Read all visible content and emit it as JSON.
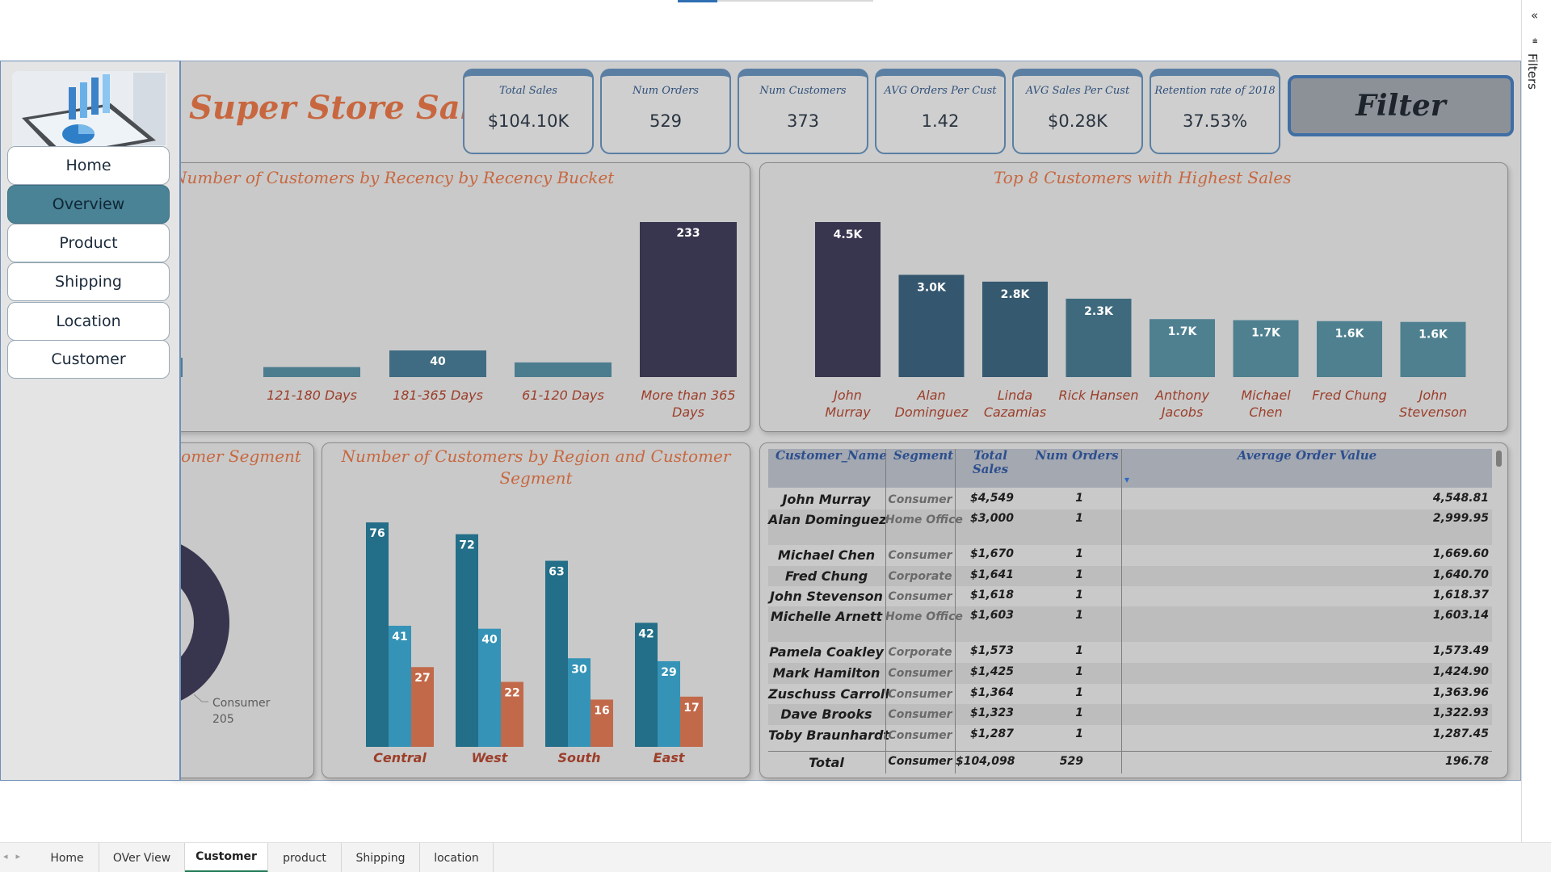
{
  "report_title": "Super Store Sales",
  "filter_button": "Filter",
  "filters_pane": {
    "label": "Filters",
    "collapse_glyph": "«",
    "funnel_glyph": "⩧"
  },
  "nav": [
    {
      "label": "Home",
      "active": false
    },
    {
      "label": "Overview",
      "active": true
    },
    {
      "label": "Product",
      "active": false
    },
    {
      "label": "Shipping",
      "active": false
    },
    {
      "label": "Location",
      "active": false
    },
    {
      "label": "Customer",
      "active": false
    }
  ],
  "kpis": [
    {
      "label": "Total Sales",
      "value": "$104.10K"
    },
    {
      "label": "Num Orders",
      "value": "529"
    },
    {
      "label": "Num Customers",
      "value": "373"
    },
    {
      "label": "AVG Orders Per Cust",
      "value": "1.42"
    },
    {
      "label": "AVG Sales Per Cust",
      "value": "$0.28K"
    },
    {
      "label": "Retention rate of 2018",
      "value": "37.53%"
    }
  ],
  "panels": {
    "recency": {
      "title": "Number of Customers by Recency by Recency Bucket"
    },
    "top_customers": {
      "title": "Top 8 Customers with Highest Sales"
    },
    "segment": {
      "title": "Number of Customers by Customer Segment"
    },
    "region": {
      "title_line1": "Number of Customers by Region and Customer",
      "title_line2": "Segment"
    }
  },
  "chart_data": [
    {
      "id": "recency",
      "type": "bar",
      "title": "Number of Customers by Recency by Recency Bucket",
      "categories": [
        "",
        "121-180 Days",
        "181-365 Days",
        "61-120 Days",
        "More than 365 Days"
      ],
      "values": [
        29,
        15,
        40,
        22,
        233
      ],
      "data_labels": [
        "",
        "",
        "40",
        "",
        "233"
      ],
      "colors": [
        "#4b7d8f",
        "#4b7d8f",
        "#3f6c82",
        "#4b7d8f",
        "#38354e"
      ]
    },
    {
      "id": "top_customers",
      "type": "bar",
      "title": "Top 8 Customers with Highest Sales",
      "categories": [
        "John Murray",
        "Alan Dominguez",
        "Linda Cazamias",
        "Rick Hansen",
        "Anthony Jacobs",
        "Michael Chen",
        "Fred Chung",
        "John Stevenson"
      ],
      "values": [
        4549,
        3000,
        2800,
        2300,
        1700,
        1670,
        1641,
        1618
      ],
      "data_labels": [
        "4.5K",
        "3.0K",
        "2.8K",
        "2.3K",
        "1.7K",
        "1.7K",
        "1.6K",
        "1.6K"
      ],
      "colors": [
        "#38354e",
        "#34566f",
        "#35596f",
        "#3f6a7e",
        "#4e8090",
        "#4e8090",
        "#4e8090",
        "#4e8090"
      ]
    },
    {
      "id": "segment",
      "type": "pie",
      "title": "Number of Customers by Customer Segment",
      "slices": [
        {
          "label": "Consumer",
          "value": 205,
          "color": "#38354e"
        }
      ],
      "visible_label": {
        "name": "Consumer",
        "value": "205"
      }
    },
    {
      "id": "region",
      "type": "bar",
      "title": "Number of Customers by Region and Customer Segment",
      "categories": [
        "Central",
        "West",
        "South",
        "East"
      ],
      "series": [
        {
          "values": [
            76,
            72,
            63,
            42
          ],
          "color": "#236e88"
        },
        {
          "values": [
            41,
            40,
            30,
            29
          ],
          "color": "#3493b6"
        },
        {
          "values": [
            27,
            22,
            16,
            17
          ],
          "color": "#c2694a"
        }
      ]
    }
  ],
  "table": {
    "headers": {
      "name": "Customer_Name",
      "segment": "Segment",
      "sales_1": "Total",
      "sales_2": "Sales",
      "orders": "Num Orders",
      "aov": "Average Order Value"
    },
    "sort_glyph": "▾",
    "rows": [
      {
        "name": "John Murray",
        "segment": "Consumer",
        "sales": "$4,549",
        "orders": "1",
        "aov": "4,548.81"
      },
      {
        "name": "Alan Dominguez",
        "segment": "Home Office",
        "sales": "$3,000",
        "orders": "1",
        "aov": "2,999.95"
      },
      {
        "name": "Michael Chen",
        "segment": "Consumer",
        "sales": "$1,670",
        "orders": "1",
        "aov": "1,669.60"
      },
      {
        "name": "Fred Chung",
        "segment": "Corporate",
        "sales": "$1,641",
        "orders": "1",
        "aov": "1,640.70"
      },
      {
        "name": "John Stevenson",
        "segment": "Consumer",
        "sales": "$1,618",
        "orders": "1",
        "aov": "1,618.37"
      },
      {
        "name": "Michelle Arnett",
        "segment": "Home Office",
        "sales": "$1,603",
        "orders": "1",
        "aov": "1,603.14"
      },
      {
        "name": "Pamela Coakley",
        "segment": "Corporate",
        "sales": "$1,573",
        "orders": "1",
        "aov": "1,573.49"
      },
      {
        "name": "Mark Hamilton",
        "segment": "Consumer",
        "sales": "$1,425",
        "orders": "1",
        "aov": "1,424.90"
      },
      {
        "name": "Zuschuss Carroll",
        "segment": "Consumer",
        "sales": "$1,364",
        "orders": "1",
        "aov": "1,363.96"
      },
      {
        "name": "Dave Brooks",
        "segment": "Consumer",
        "sales": "$1,323",
        "orders": "1",
        "aov": "1,322.93"
      },
      {
        "name": "Toby Braunhardt",
        "segment": "Consumer",
        "sales": "$1,287",
        "orders": "1",
        "aov": "1,287.45"
      }
    ],
    "total": {
      "name": "Total",
      "segment": "Consumer",
      "sales": "$104,098",
      "orders": "529",
      "aov": "196.78"
    }
  },
  "sheet_tabs": [
    {
      "label": "Home",
      "active": false
    },
    {
      "label": "OVer View",
      "active": false
    },
    {
      "label": "Customer",
      "active": true
    },
    {
      "label": "product",
      "active": false
    },
    {
      "label": "Shipping",
      "active": false
    },
    {
      "label": "location",
      "active": false
    }
  ],
  "sheet_nav_glyphs": "◂▸"
}
